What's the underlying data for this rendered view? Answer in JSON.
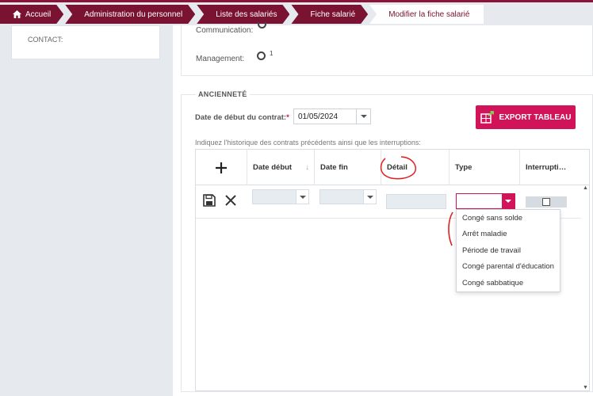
{
  "breadcrumb": {
    "items": [
      "Accueil",
      "Administration du personnel",
      "Liste des salariés",
      "Fiche salarié",
      "Modifier la fiche salarié"
    ]
  },
  "left": {
    "contact_label": "CONTACT:"
  },
  "top_fields": {
    "communication_label": "Communication:",
    "management_label": "Management:",
    "management_value": "1"
  },
  "anciennete": {
    "title": "ANCIENNETÉ",
    "start_label": "Date de début du contrat:",
    "required_mark": "*",
    "start_value": "01/05/2024",
    "export_label": "EXPORT TABLEAU",
    "hint": "Indiquez l'historique des contrats précédents ainsi que les interruptions:"
  },
  "grid": {
    "columns": [
      "Date début",
      "Date fin",
      "Détail",
      "Type",
      "Interrupti…"
    ]
  },
  "type_dropdown": {
    "options": [
      "Congé sans solde",
      "Arrêt maladie",
      "Période de travail",
      "Congé parental d'éducation",
      "Congé sabbatique"
    ]
  },
  "colors": {
    "brand": "#7a1232",
    "accent": "#d1145a",
    "annotation": "#e02020"
  }
}
